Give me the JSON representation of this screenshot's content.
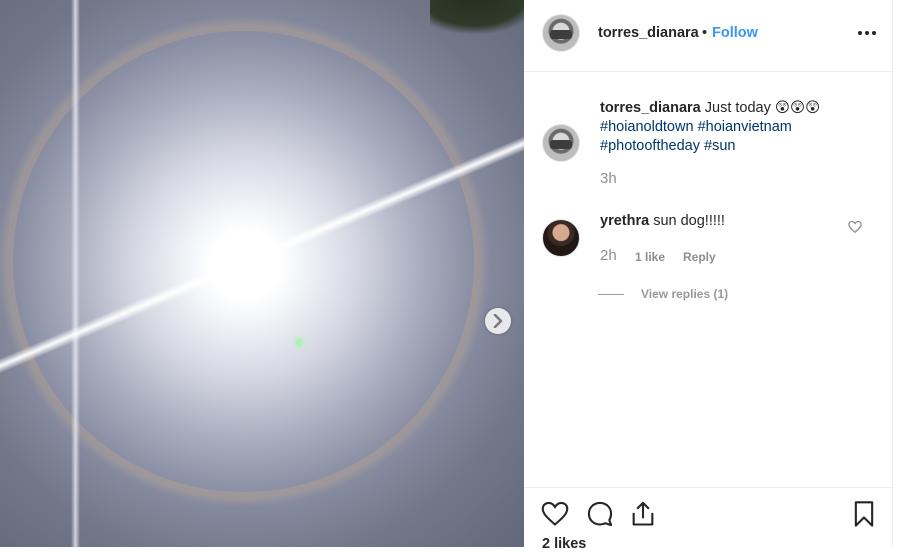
{
  "post": {
    "username": "torres_dianara",
    "separator": "•",
    "follow_label": "Follow",
    "more_icon": "more-icon",
    "next_icon": "chevron-right-icon"
  },
  "caption": {
    "username": "torres_dianara",
    "text": "Just today 😲😲😲",
    "hashtags": [
      "#hoianoldtown",
      "#hoianvietnam",
      "#photooftheday",
      "#sun"
    ],
    "time": "3h"
  },
  "comment": {
    "username": "yrethra",
    "text": "sun dog!!!!!",
    "time": "2h",
    "likes": "1 like",
    "reply_label": "Reply",
    "view_replies": "View replies (1)"
  },
  "actions": {
    "like_icon": "heart-icon",
    "comment_icon": "comment-icon",
    "share_icon": "share-icon",
    "save_icon": "bookmark-icon",
    "likes_count": "2 likes"
  },
  "colors": {
    "link": "#3897f0",
    "hashtag": "#003569",
    "text": "#262626",
    "muted": "#8e8e8e"
  }
}
